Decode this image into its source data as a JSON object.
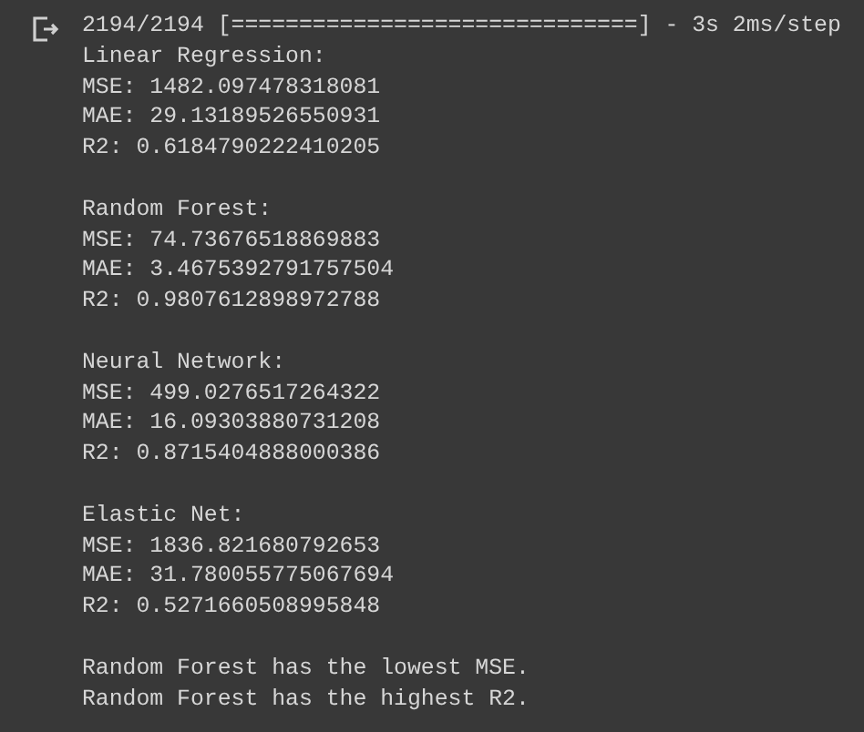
{
  "output_blocks": [
    {
      "lines": [
        "2194/2194 [==============================] - 3s 2ms/step",
        "Linear Regression:",
        "MSE: 1482.097478318081",
        "MAE: 29.13189526550931",
        "R2: 0.6184790222410205"
      ]
    },
    {
      "lines": [
        "Random Forest:",
        "MSE: 74.73676518869883",
        "MAE: 3.4675392791757504",
        "R2: 0.9807612898972788"
      ]
    },
    {
      "lines": [
        "Neural Network:",
        "MSE: 499.0276517264322",
        "MAE: 16.09303880731208",
        "R2: 0.8715404888000386"
      ]
    },
    {
      "lines": [
        "Elastic Net:",
        "MSE: 1836.821680792653",
        "MAE: 31.780055775067694",
        "R2: 0.5271660508995848"
      ]
    },
    {
      "lines": [
        "Random Forest has the lowest MSE.",
        "Random Forest has the highest R2."
      ]
    }
  ]
}
